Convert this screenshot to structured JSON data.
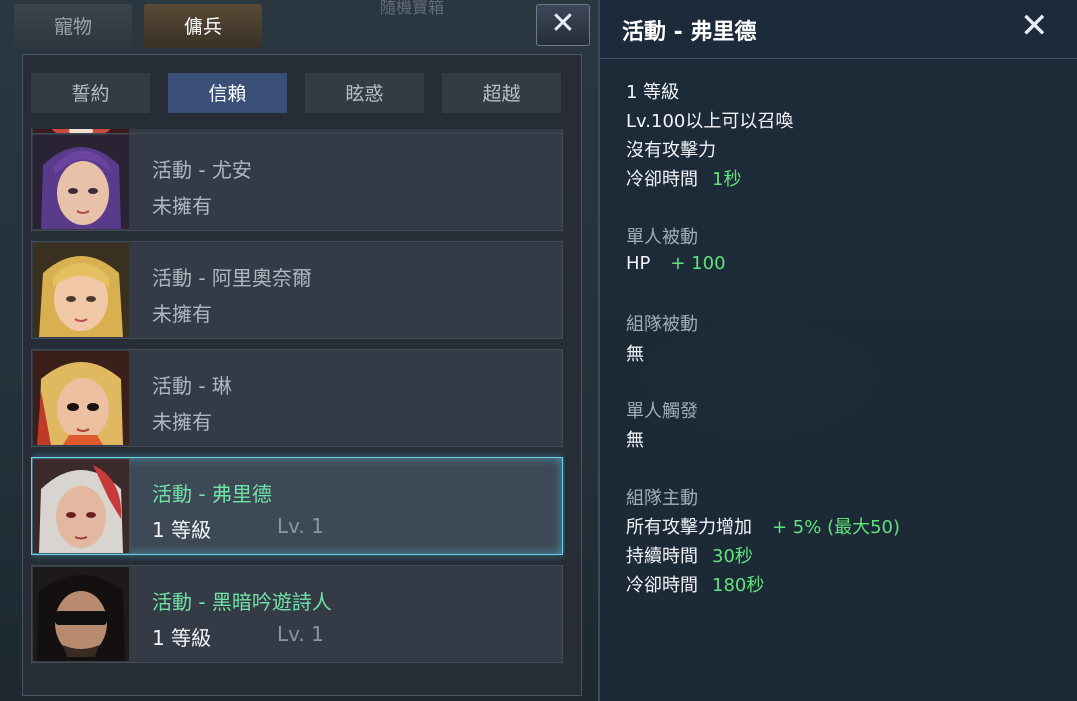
{
  "background": {
    "title": "隨機寶箱"
  },
  "left_window": {
    "close_icon": "close-icon",
    "top_tabs": [
      {
        "label": "寵物",
        "active": false
      },
      {
        "label": "傭兵",
        "active": true
      }
    ],
    "sub_tabs": [
      {
        "label": "誓約",
        "active": false
      },
      {
        "label": "信賴",
        "active": true
      },
      {
        "label": "眩惑",
        "active": false
      },
      {
        "label": "超越",
        "active": false
      }
    ],
    "mercenaries": [
      {
        "name": "活動 - 尤安",
        "status": "未擁有",
        "level": "",
        "owned": false
      },
      {
        "name": "活動 - 阿里奧奈爾",
        "status": "未擁有",
        "level": "",
        "owned": false
      },
      {
        "name": "活動 - 琳",
        "status": "未擁有",
        "level": "",
        "owned": false
      },
      {
        "name": "活動 - 弗里德",
        "status": "1 等級",
        "level": "Lv. 1",
        "owned": true,
        "selected": true
      },
      {
        "name": "活動 - 黑暗吟遊詩人",
        "status": "1 等級",
        "level": "Lv. 1",
        "owned": true
      }
    ]
  },
  "detail": {
    "title": "活動 - 弗里德",
    "level_line": "1 等級",
    "summon_line": "Lv.100以上可以召喚",
    "attack_line": "沒有攻擊力",
    "cooldown_label": "冷卻時間",
    "cooldown_value": "1秒",
    "solo_passive": {
      "label": "單人被動",
      "stat": "HP",
      "value": "+ 100"
    },
    "party_passive": {
      "label": "組隊被動",
      "value": "無"
    },
    "solo_trigger": {
      "label": "單人觸發",
      "value": "無"
    },
    "party_active": {
      "label": "組隊主動",
      "effect": "所有攻擊力增加",
      "effect_value": "+ 5% (最大50)",
      "duration_label": "持續時間",
      "duration_value": "30秒",
      "cooldown_label": "冷卻時間",
      "cooldown_value": "180秒"
    }
  },
  "colors": {
    "accent_green": "#5fe37b",
    "owned_name": "#6fe3a6",
    "selected_border": "#6ad0e8",
    "active_tab": "#3a5079"
  }
}
